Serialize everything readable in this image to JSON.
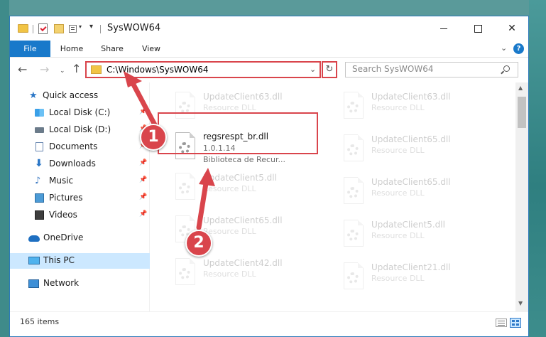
{
  "window": {
    "title": "SysWOW64",
    "quick_access_caret": "▾",
    "quick_access_down": "▾",
    "controls": {
      "close": "✕"
    }
  },
  "ribbon": {
    "tabs": [
      "File",
      "Home",
      "Share",
      "View"
    ],
    "expand_chevron": "⌄",
    "help": "?"
  },
  "navigation": {
    "back": "←",
    "forward": "→",
    "recent": "⌄",
    "up": "↑",
    "address": "C:\\Windows\\SysWOW64",
    "address_chevron": "⌄",
    "refresh": "↻",
    "search_placeholder": "Search SysWOW64"
  },
  "sidebar": {
    "items": [
      {
        "label": "Quick access",
        "icon": "star-icon",
        "pinned": false
      },
      {
        "label": "Local Disk (C:)",
        "icon": "disk-icon",
        "pinned": true
      },
      {
        "label": "Local Disk (D:)",
        "icon": "disk-icon",
        "pinned": true
      },
      {
        "label": "Documents",
        "icon": "documents-icon",
        "pinned": true
      },
      {
        "label": "Downloads",
        "icon": "downloads-icon",
        "pinned": true
      },
      {
        "label": "Music",
        "icon": "music-icon",
        "pinned": true
      },
      {
        "label": "Pictures",
        "icon": "pictures-icon",
        "pinned": true
      },
      {
        "label": "Videos",
        "icon": "videos-icon",
        "pinned": true
      },
      {
        "label": "OneDrive",
        "icon": "onedrive-icon",
        "pinned": false
      },
      {
        "label": "This PC",
        "icon": "this-pc-icon",
        "pinned": false,
        "selected": true
      },
      {
        "label": "Network",
        "icon": "network-icon",
        "pinned": false
      }
    ],
    "pin_glyph": "📌"
  },
  "files": {
    "left": [
      {
        "name": "UpdateClient63.dll",
        "type": "Resource DLL"
      },
      {
        "name": "regsrespt_br.dll",
        "version": "1.0.1.14",
        "type": "Biblioteca de Recur..."
      },
      {
        "name": "UpdateClient5.dll",
        "type": "Resource DLL"
      },
      {
        "name": "UpdateClient65.dll",
        "type": "Resource DLL"
      },
      {
        "name": "UpdateClient42.dll",
        "type": "Resource DLL"
      }
    ],
    "right": [
      {
        "name": "UpdateClient63.dll",
        "type": "Resource DLL"
      },
      {
        "name": "UpdateClient65.dll",
        "type": "Resource DLL"
      },
      {
        "name": "UpdateClient65.dll",
        "type": "Resource DLL"
      },
      {
        "name": "UpdateClient5.dll",
        "type": "Resource DLL"
      },
      {
        "name": "UpdateClient21.dll",
        "type": "Resource DLL"
      }
    ]
  },
  "scrollbar": {
    "up": "▲",
    "down": "▼"
  },
  "status": {
    "item_count": "165 items"
  },
  "annotations": {
    "accent_color": "#d9454c",
    "steps": [
      "1",
      "2"
    ]
  }
}
